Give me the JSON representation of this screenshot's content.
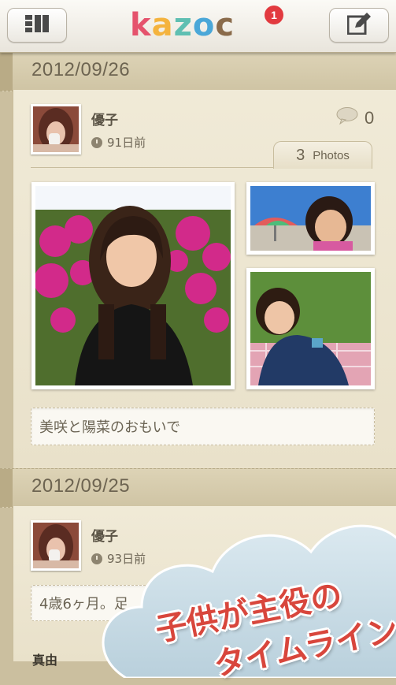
{
  "app": {
    "logo_letters": [
      "k",
      "a",
      "z",
      "o",
      "c"
    ],
    "logo_colors": [
      "#e5536d",
      "#f4b33e",
      "#5fbfb2",
      "#4aa7d8",
      "#8a6b4b"
    ],
    "notification_count": "1",
    "menu_icon": "list-menu-icon",
    "compose_icon": "compose-edit-icon"
  },
  "posts": [
    {
      "date": "2012/09/26",
      "author": "優子",
      "ago": "91日前",
      "comment_count": "0",
      "photo_count": "3",
      "photos_label": "Photos",
      "caption": "美咲と陽菜のおもいで"
    },
    {
      "date": "2012/09/25",
      "author": "優子",
      "ago": "93日前",
      "caption": "4歳6ヶ月。足",
      "section_label": "真由"
    }
  ],
  "promo": {
    "line1": "子供が主役の",
    "line2": "タイムライン"
  },
  "colors": {
    "paper": "#ebe4cf",
    "date_band": "#d6cbad",
    "promo_text": "#d8463c",
    "promo_cloud": "#c6dbe6"
  }
}
